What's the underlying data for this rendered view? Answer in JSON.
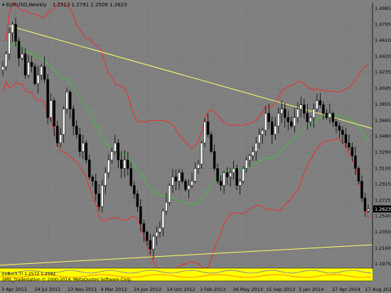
{
  "header": {
    "symbol_timeframe": "EURUSD,Weekly",
    "ohlc": "1.2513 1.2791 1.2509 1.2623"
  },
  "indicators": {
    "line1": "ExBo(3.7) 1.2572 1.2592",
    "line2": "SMIL_tradestation © 2000-2014, MetaQuotes Software Corp."
  },
  "last_price_label": "1.2623",
  "colors": {
    "background": "#808080",
    "grid": "#6e6e6e",
    "candle": "#000000",
    "bands": "#ff2020",
    "middle": "#2fcf2f",
    "trendline": "#ffff66",
    "last_box": "#000000",
    "indicator_bg": "#ffff00"
  },
  "chart_data": {
    "type": "candlestick",
    "symbol": "EURUSD",
    "timeframe": "Weekly",
    "ylim": [
      1.1975,
      1.4985
    ],
    "y_ticks": [
      "1.4985",
      "1.4795",
      "1.4610",
      "1.4420",
      "1.4235",
      "1.4045",
      "1.3855",
      "1.3665",
      "1.3480",
      "1.3290",
      "1.3100",
      "1.2915",
      "1.2725",
      "1.2540",
      "1.2350",
      "1.2160",
      "1.1975"
    ],
    "x_ticks": [
      "3 Apr 2011",
      "24 Jul 2011",
      "13 Nov 2011",
      "4 Mar 2012",
      "24 Jun 2012",
      "14 Oct 2012",
      "3 Feb 2013",
      "26 May 2013",
      "15 Sep 2013",
      "5 Jan 2014",
      "27 Apr 2014",
      "17 Aug 2014"
    ],
    "last_close": 1.2623,
    "close_anchors": [
      [
        0,
        1.43
      ],
      [
        1,
        1.445
      ],
      [
        2,
        1.47
      ],
      [
        3,
        1.48
      ],
      [
        4,
        1.46
      ],
      [
        5,
        1.44
      ],
      [
        6,
        1.445
      ],
      [
        7,
        1.42
      ],
      [
        8,
        1.435
      ],
      [
        9,
        1.43
      ],
      [
        10,
        1.41
      ],
      [
        11,
        1.42
      ],
      [
        12,
        1.43
      ],
      [
        13,
        1.415
      ],
      [
        14,
        1.37
      ],
      [
        15,
        1.39
      ],
      [
        16,
        1.36
      ],
      [
        17,
        1.34
      ],
      [
        18,
        1.35
      ],
      [
        19,
        1.38
      ],
      [
        20,
        1.4
      ],
      [
        21,
        1.38
      ],
      [
        22,
        1.36
      ],
      [
        23,
        1.35
      ],
      [
        24,
        1.33
      ],
      [
        25,
        1.34
      ],
      [
        26,
        1.32
      ],
      [
        27,
        1.3
      ],
      [
        28,
        1.295
      ],
      [
        29,
        1.28
      ],
      [
        30,
        1.265
      ],
      [
        31,
        1.29
      ],
      [
        32,
        1.305
      ],
      [
        33,
        1.32
      ],
      [
        34,
        1.33
      ],
      [
        35,
        1.34
      ],
      [
        36,
        1.32
      ],
      [
        37,
        1.31
      ],
      [
        38,
        1.32
      ],
      [
        39,
        1.31
      ],
      [
        40,
        1.29
      ],
      [
        41,
        1.28
      ],
      [
        42,
        1.265
      ],
      [
        43,
        1.245
      ],
      [
        44,
        1.235
      ],
      [
        45,
        1.225
      ],
      [
        46,
        1.215
      ],
      [
        47,
        1.23
      ],
      [
        48,
        1.235
      ],
      [
        49,
        1.24
      ],
      [
        50,
        1.26
      ],
      [
        51,
        1.27
      ],
      [
        52,
        1.29
      ],
      [
        53,
        1.3
      ],
      [
        54,
        1.295
      ],
      [
        55,
        1.305
      ],
      [
        56,
        1.295
      ],
      [
        57,
        1.285
      ],
      [
        58,
        1.29
      ],
      [
        59,
        1.295
      ],
      [
        60,
        1.31
      ],
      [
        61,
        1.315
      ],
      [
        62,
        1.34
      ],
      [
        63,
        1.365
      ],
      [
        64,
        1.35
      ],
      [
        65,
        1.33
      ],
      [
        66,
        1.31
      ],
      [
        67,
        1.295
      ],
      [
        68,
        1.29
      ],
      [
        69,
        1.305
      ],
      [
        70,
        1.3
      ],
      [
        71,
        1.305
      ],
      [
        72,
        1.31
      ],
      [
        73,
        1.29
      ],
      [
        74,
        1.295
      ],
      [
        75,
        1.31
      ],
      [
        76,
        1.32
      ],
      [
        77,
        1.325
      ],
      [
        78,
        1.33
      ],
      [
        79,
        1.34
      ],
      [
        80,
        1.35
      ],
      [
        81,
        1.355
      ],
      [
        82,
        1.375
      ],
      [
        83,
        1.365
      ],
      [
        84,
        1.35
      ],
      [
        85,
        1.36
      ],
      [
        86,
        1.375
      ],
      [
        87,
        1.38
      ],
      [
        88,
        1.37
      ],
      [
        89,
        1.365
      ],
      [
        90,
        1.36
      ],
      [
        91,
        1.37
      ],
      [
        92,
        1.38
      ],
      [
        93,
        1.385
      ],
      [
        94,
        1.375
      ],
      [
        95,
        1.365
      ],
      [
        96,
        1.37
      ],
      [
        97,
        1.38
      ],
      [
        98,
        1.39
      ],
      [
        99,
        1.385
      ],
      [
        100,
        1.375
      ],
      [
        101,
        1.37
      ],
      [
        102,
        1.375
      ],
      [
        103,
        1.365
      ],
      [
        104,
        1.36
      ],
      [
        105,
        1.355
      ],
      [
        106,
        1.35
      ],
      [
        107,
        1.34
      ],
      [
        108,
        1.335
      ],
      [
        109,
        1.325
      ],
      [
        110,
        1.31
      ],
      [
        111,
        1.295
      ],
      [
        112,
        1.275
      ],
      [
        113,
        1.26
      ],
      [
        114,
        1.2623
      ]
    ]
  }
}
